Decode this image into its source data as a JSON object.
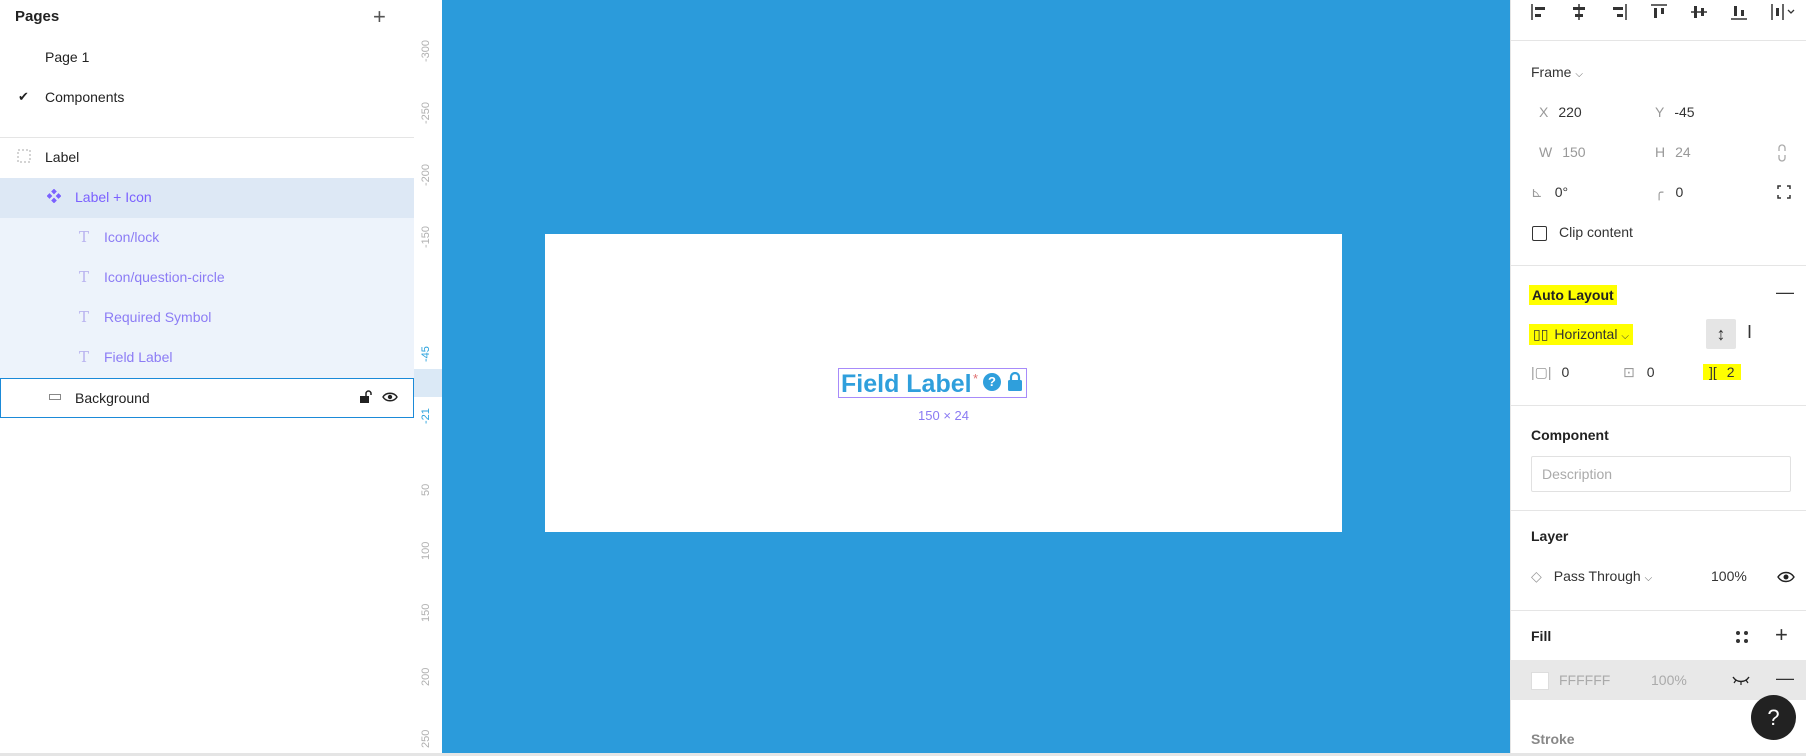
{
  "pages": {
    "header": "Pages",
    "add_icon": "+",
    "items": [
      {
        "label": "Page 1",
        "checked": false
      },
      {
        "label": "Components",
        "checked": true
      }
    ]
  },
  "layers": [
    {
      "name": "Label",
      "icon": "frame-icon"
    },
    {
      "name": "Label + Icon",
      "icon": "component-icon"
    },
    {
      "name": "Icon/lock",
      "icon": "text-icon"
    },
    {
      "name": "Icon/question-circle",
      "icon": "text-icon"
    },
    {
      "name": "Required Symbol",
      "icon": "text-icon"
    },
    {
      "name": "Field Label",
      "icon": "text-icon"
    },
    {
      "name": "Background",
      "icon": "rectangle-icon"
    }
  ],
  "ruler": {
    "ticks": [
      "-300",
      "-250",
      "-200",
      "-150",
      "-45",
      "-21",
      "50",
      "100",
      "150",
      "200",
      "250"
    ]
  },
  "canvas": {
    "component_text": "Field Label",
    "required_symbol": "*",
    "question_glyph": "?",
    "dimensions": "150 × 24",
    "background_color": "#2b9bdb"
  },
  "properties": {
    "frame_label": "Frame",
    "x_label": "X",
    "x_value": "220",
    "y_label": "Y",
    "y_value": "-45",
    "w_label": "W",
    "w_value": "150",
    "h_label": "H",
    "h_value": "24",
    "rotation": "0°",
    "radius": "0",
    "clip_content": "Clip content",
    "auto_layout_title": "Auto Layout",
    "direction": "Horizontal",
    "padding_h": "0",
    "padding_v": "0",
    "spacing": "2",
    "component_title": "Component",
    "description_placeholder": "Description",
    "layer_title": "Layer",
    "blend_mode": "Pass Through",
    "opacity": "100%",
    "fill_title": "Fill",
    "fill_hex": "FFFFFF",
    "fill_opacity": "100%",
    "stroke_title": "Stroke",
    "help_glyph": "?",
    "highlight_color": "#ffff00"
  }
}
